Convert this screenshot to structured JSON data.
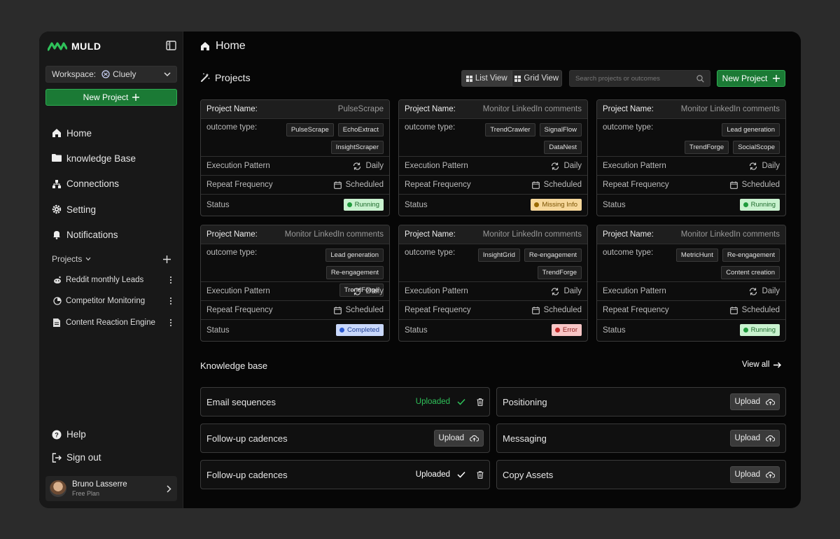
{
  "brand": {
    "name": "MULD"
  },
  "workspace": {
    "label": "Workspace:",
    "name": "Cluely"
  },
  "sidebar": {
    "new_project": "New Project",
    "nav": [
      {
        "label": "Home",
        "icon": "home-icon"
      },
      {
        "label": "knowledge Base",
        "icon": "folder-icon"
      },
      {
        "label": "Connections",
        "icon": "connections-icon"
      },
      {
        "label": "Setting",
        "icon": "gear-icon"
      },
      {
        "label": "Notifications",
        "icon": "bell-icon"
      }
    ],
    "projects_label": "Projects",
    "projects": [
      {
        "label": "Reddit monthly Leads",
        "icon": "reddit-icon"
      },
      {
        "label": "Competitor Monitoring",
        "icon": "chart-icon"
      },
      {
        "label": "Content Reaction Engine",
        "icon": "document-icon"
      }
    ],
    "help": "Help",
    "sign_out": "Sign out",
    "user": {
      "name": "Bruno Lasserre",
      "plan": "Free Plan"
    }
  },
  "header": {
    "title": "Home"
  },
  "projects_section": {
    "title": "Projects",
    "list_view": "List View",
    "grid_view": "Grid View",
    "search_placeholder": "Search projects or outcomes",
    "new_project": "New Project"
  },
  "card_labels": {
    "name": "Project Name:",
    "outcome": "outcome type:",
    "execution": "Execution Pattern",
    "repeat": "Repeat Frequency",
    "status": "Status"
  },
  "cards": [
    {
      "name": "PulseScrape",
      "tags": [
        "PulseScrape",
        "EchoExtract",
        "InsightScraper"
      ],
      "execution": "Daily",
      "repeat": "Scheduled",
      "status": "Running"
    },
    {
      "name": "Monitor LinkedIn comments",
      "tags": [
        "TrendCrawler",
        "SignalFlow",
        "DataNest"
      ],
      "execution": "Daily",
      "repeat": "Scheduled",
      "status": "Missing Info"
    },
    {
      "name": "Monitor LinkedIn comments",
      "tags": [
        "Lead generation",
        "TrendForge",
        "SocialScope"
      ],
      "execution": "Daily",
      "repeat": "Scheduled",
      "status": "Running"
    },
    {
      "name": "Monitor LinkedIn comments",
      "tags": [
        "Lead generation",
        "Re-engagement",
        "TrendForge"
      ],
      "execution": "Daily",
      "repeat": "Scheduled",
      "status": "Completed"
    },
    {
      "name": "Monitor LinkedIn comments",
      "tags": [
        "InsightGrid",
        "Re-engagement",
        "TrendForge"
      ],
      "execution": "Daily",
      "repeat": "Scheduled",
      "status": "Error"
    },
    {
      "name": "Monitor LinkedIn comments",
      "tags": [
        "MetricHunt",
        "Re-engagement",
        "Content creation"
      ],
      "execution": "Daily",
      "repeat": "Scheduled",
      "status": "Running"
    }
  ],
  "status_colors": {
    "Running": {
      "bg": "#c9f2cf",
      "fg": "#1d6b2c",
      "dot": "#1f9b3c"
    },
    "Missing Info": {
      "bg": "#f6d79a",
      "fg": "#7a5200",
      "dot": "#9a6a00"
    },
    "Completed": {
      "bg": "#c9d8fb",
      "fg": "#1f3f95",
      "dot": "#2d5bd3"
    },
    "Error": {
      "bg": "#f8c6c6",
      "fg": "#8e1d1d",
      "dot": "#c42828"
    }
  },
  "knowledge_base": {
    "title": "Knowledge base",
    "view_all": "View all",
    "items": [
      {
        "label": "Email sequences",
        "state": "uploaded",
        "state_label": "Uploaded",
        "accent": "#2fc25a"
      },
      {
        "label": "Positioning",
        "state": "upload",
        "state_label": "Upload"
      },
      {
        "label": "Follow-up cadences",
        "state": "upload",
        "state_label": "Upload"
      },
      {
        "label": "Messaging",
        "state": "upload",
        "state_label": "Upload"
      },
      {
        "label": "Follow-up cadences",
        "state": "uploaded",
        "state_label": "Uploaded",
        "accent": "#ffffff"
      },
      {
        "label": "Copy Assets",
        "state": "upload",
        "state_label": "Upload"
      }
    ]
  },
  "colors": {
    "accent": "#1b7a35",
    "accent_border": "#2fae52"
  }
}
